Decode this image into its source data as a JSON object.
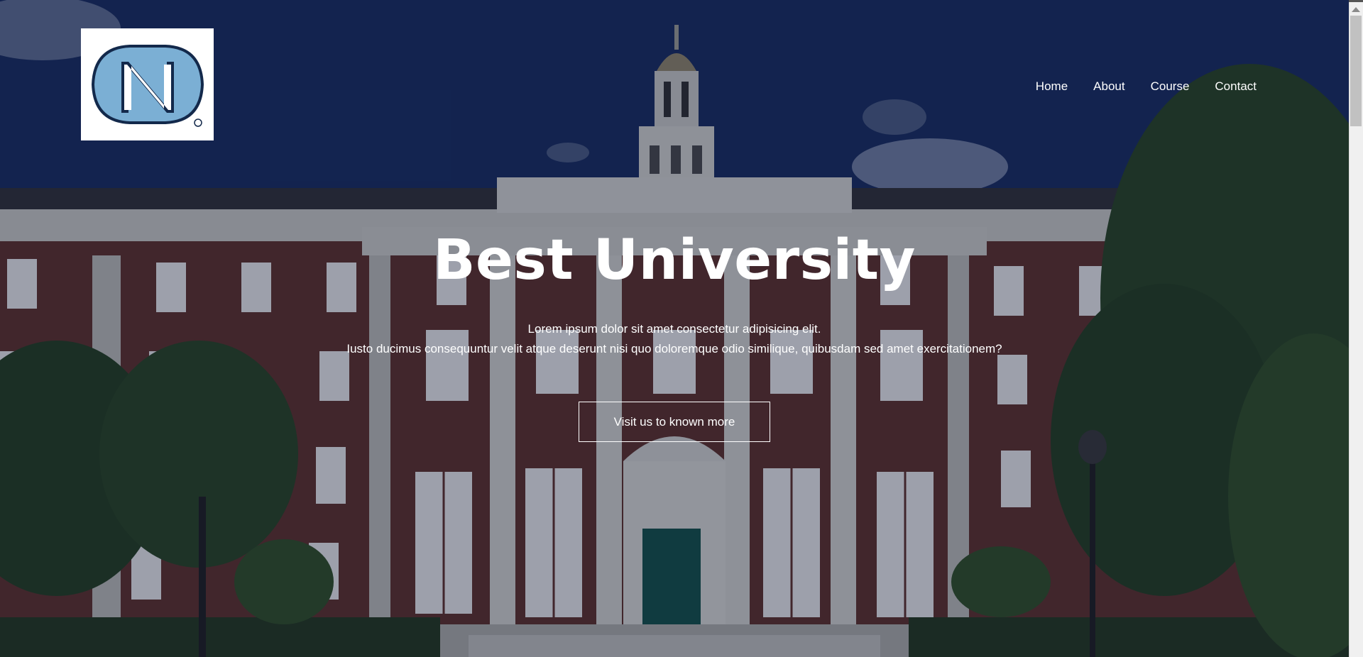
{
  "logo": {
    "alt": "NC",
    "color": "#7bafd4",
    "outline": "#13294b"
  },
  "nav": {
    "items": [
      {
        "label": "Home"
      },
      {
        "label": "About"
      },
      {
        "label": "Course"
      },
      {
        "label": "Contact"
      }
    ]
  },
  "hero": {
    "title": "Best University",
    "line1": "Lorem ipsum dolor sit amet consectetur adipisicing elit.",
    "line2": "Iusto ducimus consequuntur velit atque deserunt nisi quo doloremque odio similique, quibusdam sed amet exercitationem?",
    "cta_label": "Visit us to known more"
  },
  "colors": {
    "sky": "#0f1f4a",
    "brick": "#5a2c24",
    "stone": "#c9c9c4",
    "text": "#ffffff"
  }
}
